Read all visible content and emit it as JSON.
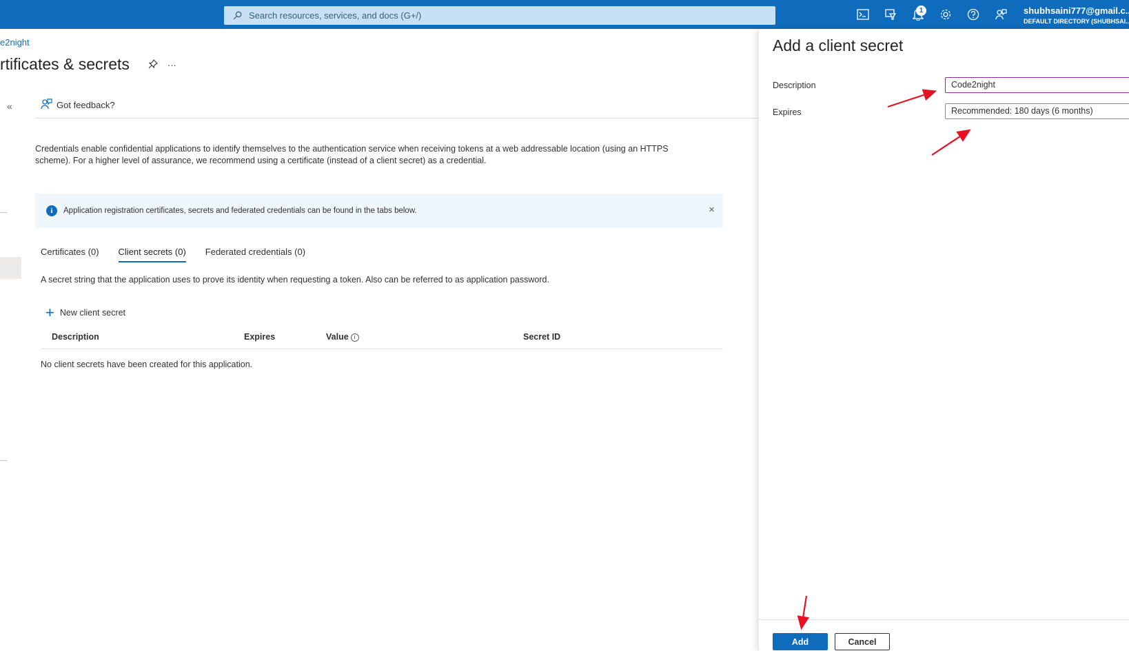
{
  "topbar": {
    "search_placeholder": "Search resources, services, and docs (G+/)",
    "notification_count": "1",
    "account_email": "shubhsaini777@gmail.c...",
    "account_directory": "DEFAULT DIRECTORY (SHUBHSAI..."
  },
  "page": {
    "breadcrumb": "e2night",
    "title": "rtificates & secrets",
    "more_label": "···",
    "collapse_label": "«",
    "feedback_label": "Got feedback?",
    "intro": "Credentials enable confidential applications to identify themselves to the authentication service when receiving tokens at a web addressable location (using an HTTPS scheme). For a higher level of assurance, we recommend using a certificate (instead of a client secret) as a credential.",
    "info_message": "Application registration certificates, secrets and federated credentials can be found in the tabs below.",
    "close_label": "×",
    "tabs": [
      {
        "label": "Certificates (0)"
      },
      {
        "label": "Client secrets (0)"
      },
      {
        "label": "Federated credentials (0)"
      }
    ],
    "tab_description": "A secret string that the application uses to prove its identity when requesting a token. Also can be referred to as application password.",
    "new_secret_label": "New client secret",
    "columns": [
      "Description",
      "Expires",
      "Value",
      "Secret ID"
    ],
    "empty_message": "No client secrets have been created for this application."
  },
  "panel": {
    "title": "Add a client secret",
    "description_label": "Description",
    "description_value": "Code2night",
    "expires_label": "Expires",
    "expires_value": "Recommended: 180 days (6 months)",
    "add_label": "Add",
    "cancel_label": "Cancel"
  },
  "colors": {
    "accent": "#0f6cbd",
    "annotation_arrow": "#e81123"
  }
}
